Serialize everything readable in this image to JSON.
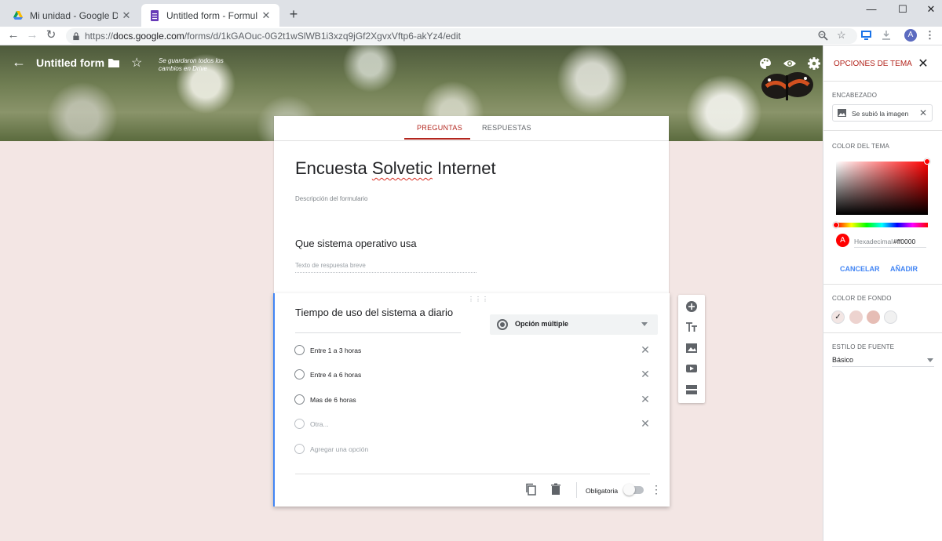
{
  "browser": {
    "tabs": [
      {
        "title": "Mi unidad - Google Drive"
      },
      {
        "title": "Untitled form - Formularios de G"
      }
    ],
    "new_tab": "+",
    "window": {
      "minimize": "—",
      "maximize": "☐",
      "close": "✕"
    },
    "url_prefix": "https://",
    "url_host": "docs.google.com",
    "url_path": "/forms/d/1kGAOuc-0G2t1wSlWB1i3xzq9jGf2XgvxVftp6-akYz4/edit",
    "avatar_letter": "A"
  },
  "header": {
    "form_title": "Untitled form",
    "saved_status": "Se guardaron todos los cambios en Drive"
  },
  "form": {
    "tabs": [
      "PREGUNTAS",
      "RESPUESTAS"
    ],
    "title_pre": "Encuesta ",
    "title_misspelled": "Solvetic",
    "title_post": " Internet",
    "description_placeholder": "Descripción del formulario",
    "q1": {
      "title": "Que sistema operativo usa",
      "answer_placeholder": "Texto de respuesta breve"
    },
    "q2": {
      "title": "Tiempo de uso del sistema a diario",
      "type": "Opción múltiple",
      "options": [
        "Entre 1 a 3 horas",
        "Entre 4 a 6 horas",
        "Mas de 6 horas"
      ],
      "other_placeholder": "Otra...",
      "add_option": "Agregar una opción",
      "required_label": "Obligatoria",
      "required": false
    }
  },
  "theme_panel": {
    "title": "OPCIONES DE TEMA",
    "header_label": "ENCABEZADO",
    "header_value": "Se subió la imagen",
    "theme_color_label": "COLOR DEL TEMA",
    "hex_label": "Hexadecimal",
    "hex_value": "#ff0000",
    "swatch_letter": "A",
    "cancel": "CANCELAR",
    "add": "AÑADIR",
    "bg_color_label": "COLOR DE FONDO",
    "bg_colors": [
      "#f3e6e4",
      "#edd3cf",
      "#e6bdb5",
      "#f1f1f1"
    ],
    "font_style_label": "ESTILO DE FUENTE",
    "font_style_value": "Básico",
    "accent": "#b3261e",
    "theme_color": "#ff0000"
  }
}
